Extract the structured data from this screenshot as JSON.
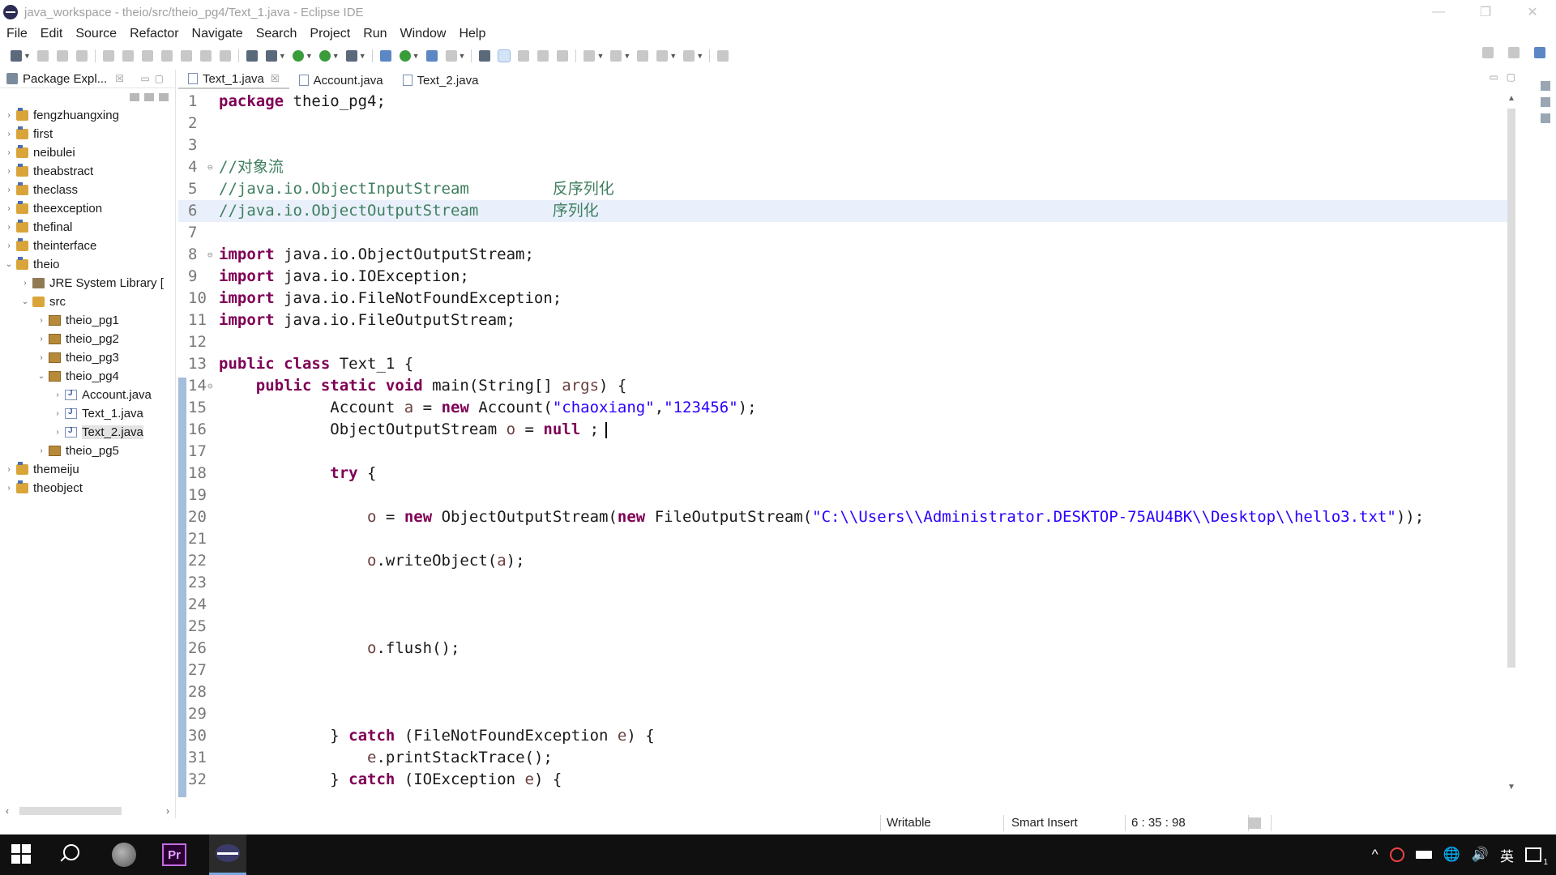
{
  "window": {
    "title": "java_workspace - theio/src/theio_pg4/Text_1.java - Eclipse IDE",
    "controls": [
      "—",
      "❐",
      "✕"
    ]
  },
  "menu": [
    "File",
    "Edit",
    "Source",
    "Refactor",
    "Navigate",
    "Search",
    "Project",
    "Run",
    "Window",
    "Help"
  ],
  "package_explorer": {
    "title": "Package Expl...",
    "close": "☒",
    "tree": [
      {
        "label": "fengzhuangxing",
        "depth": 0,
        "icon": "project",
        "twisty": "›"
      },
      {
        "label": "first",
        "depth": 0,
        "icon": "project",
        "twisty": "›"
      },
      {
        "label": "neibulei",
        "depth": 0,
        "icon": "project",
        "twisty": "›"
      },
      {
        "label": "theabstract",
        "depth": 0,
        "icon": "project",
        "twisty": "›"
      },
      {
        "label": "theclass",
        "depth": 0,
        "icon": "project",
        "twisty": "›"
      },
      {
        "label": "theexception",
        "depth": 0,
        "icon": "project",
        "twisty": "›"
      },
      {
        "label": "thefinal",
        "depth": 0,
        "icon": "project",
        "twisty": "›"
      },
      {
        "label": "theinterface",
        "depth": 0,
        "icon": "project",
        "twisty": "›"
      },
      {
        "label": "theio",
        "depth": 0,
        "icon": "project",
        "twisty": "⌄"
      },
      {
        "label": "JRE System Library [",
        "depth": 1,
        "icon": "library",
        "twisty": "›"
      },
      {
        "label": "src",
        "depth": 1,
        "icon": "source-folder",
        "twisty": "⌄"
      },
      {
        "label": "theio_pg1",
        "depth": 2,
        "icon": "package",
        "twisty": "›"
      },
      {
        "label": "theio_pg2",
        "depth": 2,
        "icon": "package",
        "twisty": "›"
      },
      {
        "label": "theio_pg3",
        "depth": 2,
        "icon": "package",
        "twisty": "›"
      },
      {
        "label": "theio_pg4",
        "depth": 2,
        "icon": "package",
        "twisty": "⌄"
      },
      {
        "label": "Account.java",
        "depth": 3,
        "icon": "java-file",
        "twisty": "›"
      },
      {
        "label": "Text_1.java",
        "depth": 3,
        "icon": "java-file",
        "twisty": "›"
      },
      {
        "label": "Text_2.java",
        "depth": 3,
        "icon": "java-file",
        "twisty": "›",
        "selected": true
      },
      {
        "label": "theio_pg5",
        "depth": 2,
        "icon": "package",
        "twisty": "›"
      },
      {
        "label": "themeiju",
        "depth": 0,
        "icon": "project",
        "twisty": "›"
      },
      {
        "label": "theobject",
        "depth": 0,
        "icon": "project",
        "twisty": "›"
      }
    ]
  },
  "editor": {
    "tabs": [
      {
        "label": "Text_1.java",
        "active": true,
        "close": "☒"
      },
      {
        "label": "Account.java",
        "active": false
      },
      {
        "label": "Text_2.java",
        "active": false
      }
    ],
    "current_line": 6,
    "cursor_line": 16,
    "lines": [
      {
        "n": "1",
        "fold": "",
        "tokens": [
          {
            "t": "kw",
            "v": "package"
          },
          {
            "t": "p",
            "v": " theio_pg4;"
          }
        ]
      },
      {
        "n": "2",
        "fold": "",
        "tokens": []
      },
      {
        "n": "3",
        "fold": "",
        "tokens": []
      },
      {
        "n": "4",
        "fold": "⊖",
        "tokens": [
          {
            "t": "cm",
            "v": "//对象流"
          }
        ]
      },
      {
        "n": "5",
        "fold": "",
        "tokens": [
          {
            "t": "cm",
            "v": "//java.io.ObjectInputStream         反序列化"
          }
        ]
      },
      {
        "n": "6",
        "fold": "",
        "tokens": [
          {
            "t": "cm",
            "v": "//java.io.ObjectOutputStream        序列化"
          }
        ]
      },
      {
        "n": "7",
        "fold": "",
        "tokens": []
      },
      {
        "n": "8",
        "fold": "⊖",
        "tokens": [
          {
            "t": "kw",
            "v": "import"
          },
          {
            "t": "p",
            "v": " java.io.ObjectOutputStream;"
          }
        ]
      },
      {
        "n": "9",
        "fold": "",
        "tokens": [
          {
            "t": "kw",
            "v": "import"
          },
          {
            "t": "p",
            "v": " java.io.IOException;"
          }
        ]
      },
      {
        "n": "10",
        "fold": "",
        "tokens": [
          {
            "t": "kw",
            "v": "import"
          },
          {
            "t": "p",
            "v": " java.io.FileNotFoundException;"
          }
        ]
      },
      {
        "n": "11",
        "fold": "",
        "tokens": [
          {
            "t": "kw",
            "v": "import"
          },
          {
            "t": "p",
            "v": " java.io.FileOutputStream;"
          }
        ]
      },
      {
        "n": "12",
        "fold": "",
        "tokens": []
      },
      {
        "n": "13",
        "fold": "",
        "tokens": [
          {
            "t": "kw",
            "v": "public class"
          },
          {
            "t": "p",
            "v": " Text_1 {"
          }
        ]
      },
      {
        "n": "14",
        "fold": "⊖",
        "tokens": [
          {
            "t": "p",
            "v": "    "
          },
          {
            "t": "kw",
            "v": "public static void"
          },
          {
            "t": "p",
            "v": " main(String[] "
          },
          {
            "t": "vr",
            "v": "args"
          },
          {
            "t": "p",
            "v": ") {"
          }
        ]
      },
      {
        "n": "15",
        "fold": "",
        "tokens": [
          {
            "t": "p",
            "v": "            Account "
          },
          {
            "t": "vr",
            "v": "a"
          },
          {
            "t": "p",
            "v": " = "
          },
          {
            "t": "kw",
            "v": "new"
          },
          {
            "t": "p",
            "v": " Account("
          },
          {
            "t": "st",
            "v": "\"chaoxiang\""
          },
          {
            "t": "p",
            "v": ","
          },
          {
            "t": "st",
            "v": "\"123456\""
          },
          {
            "t": "p",
            "v": ");"
          }
        ]
      },
      {
        "n": "16",
        "fold": "",
        "tokens": [
          {
            "t": "p",
            "v": "            ObjectOutputStream "
          },
          {
            "t": "vr",
            "v": "o"
          },
          {
            "t": "p",
            "v": " = "
          },
          {
            "t": "kw",
            "v": "null"
          },
          {
            "t": "p",
            "v": " ;"
          }
        ]
      },
      {
        "n": "17",
        "fold": "",
        "tokens": []
      },
      {
        "n": "18",
        "fold": "",
        "tokens": [
          {
            "t": "p",
            "v": "            "
          },
          {
            "t": "kw",
            "v": "try"
          },
          {
            "t": "p",
            "v": " {"
          }
        ]
      },
      {
        "n": "19",
        "fold": "",
        "tokens": []
      },
      {
        "n": "20",
        "fold": "",
        "tokens": [
          {
            "t": "p",
            "v": "                "
          },
          {
            "t": "vr",
            "v": "o"
          },
          {
            "t": "p",
            "v": " = "
          },
          {
            "t": "kw",
            "v": "new"
          },
          {
            "t": "p",
            "v": " ObjectOutputStream("
          },
          {
            "t": "kw",
            "v": "new"
          },
          {
            "t": "p",
            "v": " FileOutputStream("
          },
          {
            "t": "st",
            "v": "\"C:\\\\Users\\\\Administrator.DESKTOP-75AU4BK\\\\Desktop\\\\hello3.txt\""
          },
          {
            "t": "p",
            "v": "));"
          }
        ]
      },
      {
        "n": "21",
        "fold": "",
        "tokens": []
      },
      {
        "n": "22",
        "fold": "",
        "tokens": [
          {
            "t": "p",
            "v": "                "
          },
          {
            "t": "vr",
            "v": "o"
          },
          {
            "t": "p",
            "v": ".writeObject("
          },
          {
            "t": "vr",
            "v": "a"
          },
          {
            "t": "p",
            "v": ");"
          }
        ]
      },
      {
        "n": "23",
        "fold": "",
        "tokens": []
      },
      {
        "n": "24",
        "fold": "",
        "tokens": []
      },
      {
        "n": "25",
        "fold": "",
        "tokens": []
      },
      {
        "n": "26",
        "fold": "",
        "tokens": [
          {
            "t": "p",
            "v": "                "
          },
          {
            "t": "vr",
            "v": "o"
          },
          {
            "t": "p",
            "v": ".flush();"
          }
        ]
      },
      {
        "n": "27",
        "fold": "",
        "tokens": []
      },
      {
        "n": "28",
        "fold": "",
        "tokens": []
      },
      {
        "n": "29",
        "fold": "",
        "tokens": []
      },
      {
        "n": "30",
        "fold": "",
        "tokens": [
          {
            "t": "p",
            "v": "            } "
          },
          {
            "t": "kw",
            "v": "catch"
          },
          {
            "t": "p",
            "v": " (FileNotFoundException "
          },
          {
            "t": "vr",
            "v": "e"
          },
          {
            "t": "p",
            "v": ") {"
          }
        ]
      },
      {
        "n": "31",
        "fold": "",
        "tokens": [
          {
            "t": "p",
            "v": "                "
          },
          {
            "t": "vr",
            "v": "e"
          },
          {
            "t": "p",
            "v": ".printStackTrace();"
          }
        ]
      },
      {
        "n": "32",
        "fold": "",
        "tokens": [
          {
            "t": "p",
            "v": "            } "
          },
          {
            "t": "kw",
            "v": "catch"
          },
          {
            "t": "p",
            "v": " (IOException "
          },
          {
            "t": "vr",
            "v": "e"
          },
          {
            "t": "p",
            "v": ") {"
          }
        ]
      }
    ]
  },
  "status": {
    "writable": "Writable",
    "insert_mode": "Smart Insert",
    "position": "6 : 35 : 98"
  },
  "taskbar": {
    "premiere_label": "Pr",
    "tray_input": "英",
    "tray_chevron": "^",
    "tray_globe": "🌐",
    "tray_volume": "🔊"
  },
  "colors": {
    "keyword": "#7f0055",
    "comment": "#3f7f5f",
    "string": "#2a00ff",
    "variable": "#6a3e3e",
    "current_line": "#e9f0fb",
    "gutter_marker": "#a4bedc"
  },
  "icons": {
    "app": "eclipse-icon",
    "start": "windows-start-icon",
    "search": "search-icon"
  }
}
